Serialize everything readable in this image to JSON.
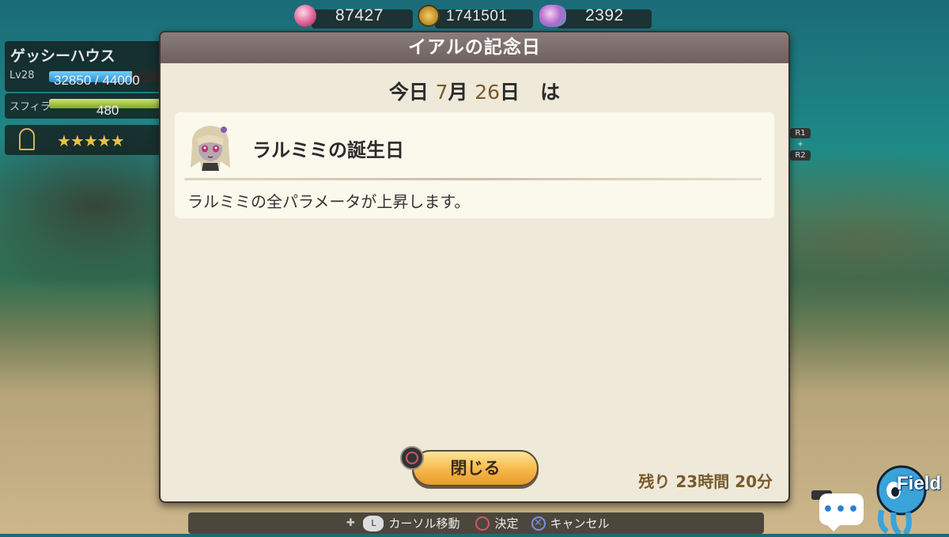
{
  "hud": {
    "crystal": "87427",
    "coins": "1741501",
    "fish": "2392",
    "house_name": "ゲッシーハウス",
    "level_label": "Lv28",
    "exp_text": "32850 / 44000",
    "exp_progress": 0.75,
    "sfira_label": "スフィラ",
    "sfira_value": "480",
    "stars": "★★★★★",
    "right_hint_top": "R1",
    "right_hint_mid": "+",
    "right_hint_bottom": "R2",
    "field_label": "Field",
    "chat_dots": "•••"
  },
  "dialog": {
    "title": "イアルの記念日",
    "date_prefix": "今日",
    "month": "7",
    "month_unit": "月",
    "day": "26",
    "day_unit": "日",
    "date_suffix": "は",
    "event_title": "ラルミミの誕生日",
    "event_desc": "ラルミミの全パラメータが上昇します。",
    "close_label": "閉じる",
    "remaining": "残り 23時間 20分"
  },
  "footer": {
    "move_label": "カーソル移動",
    "confirm_label": "決定",
    "cancel_label": "キャンセル"
  },
  "colors": {
    "header": "#7a6c6a",
    "panel": "#efe9d9",
    "accent_text": "#7a5a2c",
    "button": "#f5b84a"
  }
}
